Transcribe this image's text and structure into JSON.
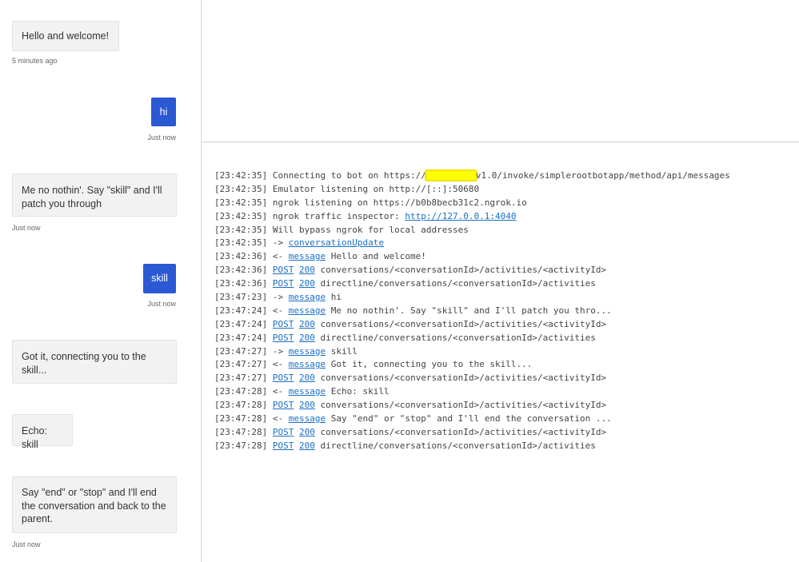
{
  "chat": {
    "messages": [
      {
        "from": "bot",
        "text": "Hello and welcome!",
        "time": "5 minutes ago"
      },
      {
        "from": "user",
        "text": "hi",
        "time": "Just now"
      },
      {
        "from": "bot",
        "text": "Me no nothin'. Say \"skill\" and I'll patch you through",
        "time": "Just now"
      },
      {
        "from": "user",
        "text": "skill",
        "time": "Just now"
      },
      {
        "from": "bot",
        "text": "Got it, connecting you to the skill..."
      },
      {
        "from": "bot",
        "text": "Echo: skill"
      },
      {
        "from": "bot",
        "text": "Say \"end\" or \"stop\" and I'll end the conversation and back to the parent.",
        "time": "Just now"
      }
    ]
  },
  "log": {
    "lines": [
      {
        "ts": "[23:42:35]",
        "pre": " Connecting to bot on https://",
        "post": "v1.0/invoke/simplerootbotapp/method/api/messages",
        "redacted": true
      },
      {
        "ts": "[23:42:35]",
        "text": " Emulator listening on http://[::]:50680"
      },
      {
        "ts": "[23:42:35]",
        "text": " ngrok listening on https://b0b8becb31c2.ngrok.io"
      },
      {
        "ts": "[23:42:35]",
        "text": " ngrok traffic inspector: ",
        "link": "http://127.0.0.1:4040"
      },
      {
        "ts": "[23:42:35]",
        "text": " Will bypass ngrok for local addresses"
      },
      {
        "ts": "[23:42:35]",
        "text": " -> ",
        "link": "conversationUpdate"
      },
      {
        "ts": "[23:42:36]",
        "text": " <- ",
        "link": "message",
        "after": " Hello and welcome!"
      },
      {
        "ts": "[23:42:36]",
        "method": "POST",
        "status": "200",
        "path": "conversations/<conversationId>/activities/<activityId>"
      },
      {
        "ts": "[23:42:36]",
        "method": "POST",
        "status": "200",
        "path": "directline/conversations/<conversationId>/activities"
      },
      {
        "ts": "[23:47:23]",
        "text": " -> ",
        "link": "message",
        "after": " hi"
      },
      {
        "ts": "[23:47:24]",
        "text": " <- ",
        "link": "message",
        "after": " Me no nothin'. Say \"skill\" and I'll patch you thro..."
      },
      {
        "ts": "[23:47:24]",
        "method": "POST",
        "status": "200",
        "path": "conversations/<conversationId>/activities/<activityId>"
      },
      {
        "ts": "[23:47:24]",
        "method": "POST",
        "status": "200",
        "path": "directline/conversations/<conversationId>/activities"
      },
      {
        "ts": "[23:47:27]",
        "text": " -> ",
        "link": "message",
        "after": " skill"
      },
      {
        "ts": "[23:47:27]",
        "text": " <- ",
        "link": "message",
        "after": " Got it, connecting you to the skill..."
      },
      {
        "ts": "[23:47:27]",
        "method": "POST",
        "status": "200",
        "path": "conversations/<conversationId>/activities/<activityId>"
      },
      {
        "ts": "[23:47:28]",
        "text": " <- ",
        "link": "message",
        "after": " Echo: skill"
      },
      {
        "ts": "[23:47:28]",
        "method": "POST",
        "status": "200",
        "path": "conversations/<conversationId>/activities/<activityId>"
      },
      {
        "ts": "[23:47:28]",
        "text": " <- ",
        "link": "message",
        "after": " Say \"end\" or \"stop\" and I'll end the conversation ..."
      },
      {
        "ts": "[23:47:28]",
        "method": "POST",
        "status": "200",
        "path": "conversations/<conversationId>/activities/<activityId>"
      },
      {
        "ts": "[23:47:28]",
        "method": "POST",
        "status": "200",
        "path": "directline/conversations/<conversationId>/activities"
      }
    ]
  },
  "colors": {
    "user_bubble": "#2b58d3",
    "bot_bubble": "#f2f2f2",
    "link": "#1a6fc6",
    "redaction": "#ffff00"
  }
}
